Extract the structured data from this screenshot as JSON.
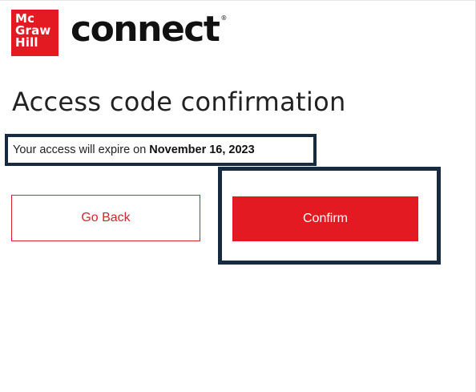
{
  "header": {
    "logo": {
      "line1": "Mc",
      "line2": "Graw",
      "line3": "Hill"
    },
    "brand_name": "connect",
    "brand_mark": "®"
  },
  "main": {
    "title": "Access code confirmation",
    "expiry_prefix": "Your access will expire on",
    "expiry_date": "November 16, 2023",
    "back_label": "Go Back",
    "confirm_label": "Confirm"
  },
  "colors": {
    "brand_red": "#e31a22",
    "highlight_navy": "#172a3f"
  }
}
